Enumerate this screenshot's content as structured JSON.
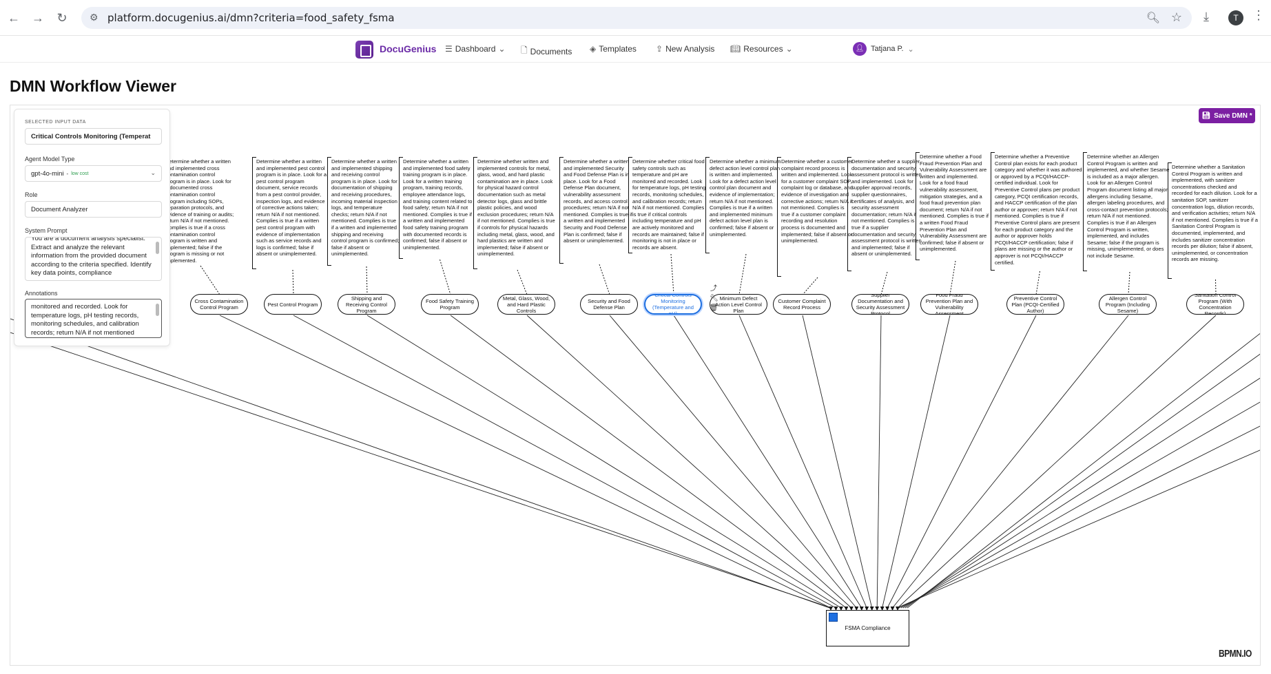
{
  "browser": {
    "url": "platform.docugenius.ai/dmn?criteria=food_safety_fsma",
    "profile_initial": "T"
  },
  "header": {
    "brand": "DocuGenius",
    "nav": [
      {
        "label": "Dashboard",
        "icon": "menu-icon",
        "dropdown": true
      },
      {
        "label": "Documents",
        "icon": "document-icon",
        "dropdown": false
      },
      {
        "label": "Templates",
        "icon": "layers-icon",
        "dropdown": false
      },
      {
        "label": "New Analysis",
        "icon": "upload-icon",
        "dropdown": false
      },
      {
        "label": "Resources",
        "icon": "book-icon",
        "dropdown": true
      }
    ],
    "user": "Tatjana P."
  },
  "page": {
    "title": "DMN Workflow Viewer",
    "save_label": "Save DMN *",
    "watermark": "BPMN.IO"
  },
  "panel": {
    "selected_label": "SELECTED INPUT DATA",
    "selected_value": "Critical Controls Monitoring (Temperat",
    "agent_label": "Agent Model Type",
    "agent_value": "gpt-4o-mini",
    "agent_badge": "low cost",
    "role_label": "Role",
    "role_value": "Document Analyzer",
    "prompt_label": "System Prompt",
    "prompt_value": "You are a document analysis specialist. Extract and analyze the relevant information from the provided document according to the criteria specified. Identify key data points, compliance",
    "annotations_label": "Annotations",
    "annotations_value": "monitored and recorded. Look for temperature logs, pH testing records, monitoring schedules, and calibration records; return N/A if not mentioned"
  },
  "diagram": {
    "decision": "FSMA Compliance",
    "inputs": [
      {
        "label": "Cross Contamination Control Program",
        "annotation": "Determine whether a written and implemented cross contamination control program is in place. Look for a documented cross contamination control program including SOPs, separation protocols, and evidence of training or audits; return N/A if not mentioned. Complies is true if a cross contamination control program is written and implemented; false if the program is missing or not implemented."
      },
      {
        "label": "Pest Control Program",
        "annotation": "Determine whether a written and implemented pest control program is in place. Look for a pest control program document, service records from a pest control provider, inspection logs, and evidence of corrective actions taken; return N/A if not mentioned. Complies is true if a written pest control program with evidence of implementation such as service records and logs is confirmed; false if absent or unimplemented."
      },
      {
        "label": "Shipping and Receiving Control Program",
        "annotation": "Determine whether a written and implemented shipping and receiving control program is in place. Look for documentation of shipping and receiving procedures, incoming material inspection logs, and temperature checks; return N/A if not mentioned. Complies is true if a written and implemented shipping and receiving control program is confirmed; false if absent or unimplemented."
      },
      {
        "label": "Food Safety Training Program",
        "annotation": "Determine whether a written and implemented food safety training program is in place. Look for a written training program, training records, employee attendance logs, and training content related to food safety; return N/A if not mentioned. Complies is true if a written and implemented food safety training program with documented records is confirmed; false if absent or unimplemented."
      },
      {
        "label": "Metal, Glass, Wood, and Hard Plastic Controls",
        "annotation": "Determine whether written and implemented controls for metal, glass, wood, and hard plastic contamination are in place. Look for physical hazard control documentation such as metal detector logs, glass and brittle plastic policies, and wood exclusion procedures; return N/A if not mentioned. Complies is true if controls for physical hazards including metal, glass, wood, and hard plastics are written and implemented; false if absent or unimplemented."
      },
      {
        "label": "Security and Food Defense Plan",
        "annotation": "Determine whether a written and implemented Security and Food Defense Plan is in place. Look for a Food Defense Plan document, vulnerability assessment records, and access control procedures; return N/A if not mentioned. Complies is true if a written and implemented Security and Food Defense Plan is confirmed; false if absent or unimplemented."
      },
      {
        "label": "Critical Controls Monitoring (Temperature and pH)",
        "annotation": "Determine whether critical food safety controls such as temperature and pH are monitored and recorded. Look for temperature logs, pH testing records, monitoring schedules, and calibration records; return N/A if not mentioned. Complies is true if critical controls including temperature and pH are actively monitored and records are maintained; false if monitoring is not in place or records are absent."
      },
      {
        "label": "Minimum Defect Action Level Control Plan",
        "annotation": "Determine whether a minimum defect action level control plan is written and implemented. Look for a defect action level control plan document and evidence of implementation; return N/A if not mentioned. Complies is true if a written and implemented minimum defect action level plan is confirmed; false if absent or unimplemented."
      },
      {
        "label": "Customer Complaint Record Process",
        "annotation": "Determine whether a customer complaint record process is written and implemented. Look for a customer complaint SOP, complaint log or database, and evidence of investigation and corrective actions; return N/A if not mentioned. Complies is true if a customer complaint recording and resolution process is documented and implemented; false if absent or unimplemented."
      },
      {
        "label": "Supplier Documentation and Security Assessment Protocol",
        "annotation": "Determine whether a supplier documentation and security assessment protocol is written and implemented. Look for supplier approval records, supplier questionnaires, certificates of analysis, and security assessment documentation; return N/A if not mentioned. Complies is true if a supplier documentation and security assessment protocol is written and implemented; false if absent or unimplemented."
      },
      {
        "label": "Food Fraud Prevention Plan and Vulnerability Assessment",
        "annotation": "Determine whether a Food Fraud Prevention Plan and Vulnerability Assessment are written and implemented. Look for a food fraud vulnerability assessment, mitigation strategies, and a food fraud prevention plan document; return N/A if not mentioned. Complies is true if a written Food Fraud Prevention Plan and Vulnerability Assessment are confirmed; false if absent or unimplemented."
      },
      {
        "label": "Preventive Control Plan (PCQI-Certified Author)",
        "annotation": "Determine whether a Preventive Control plan exists for each product category and whether it was authored or approved by a PCQI/HACCP-certified individual. Look for Preventive Control plans per product category, PCQI certification records, and HACCP certification of the plan author or approver; return N/A if not mentioned. Complies is true if Preventive Control plans are present for each product category and the author or approver holds PCQI/HACCP certification; false if plans are missing or the author or approver is not PCQI/HACCP certified."
      },
      {
        "label": "Allergen Control Program (Including Sesame)",
        "annotation": "Determine whether an Allergen Control Program is written and implemented, and whether Sesame is included as a major allergen. Look for an Allergen Control Program document listing all major allergens including Sesame, allergen labeling procedures, and cross-contact prevention protocols; return N/A if not mentioned. Complies is true if an Allergen Control Program is written, implemented, and includes Sesame; false if the program is missing, unimplemented, or does not include Sesame."
      },
      {
        "label": "Sanitation Control Program (With Concentration Records)",
        "annotation": "Determine whether a Sanitation Control Program is written and implemented, with sanitizer concentrations checked and recorded for each dilution. Look for a sanitation SOP, sanitizer concentration logs, dilution records, and verification activities; return N/A if not mentioned. Complies is true if a Sanitation Control Program is documented, implemented, and includes sanitizer concentration records per dilution; false if absent, unimplemented, or concentration records are missing."
      }
    ]
  }
}
